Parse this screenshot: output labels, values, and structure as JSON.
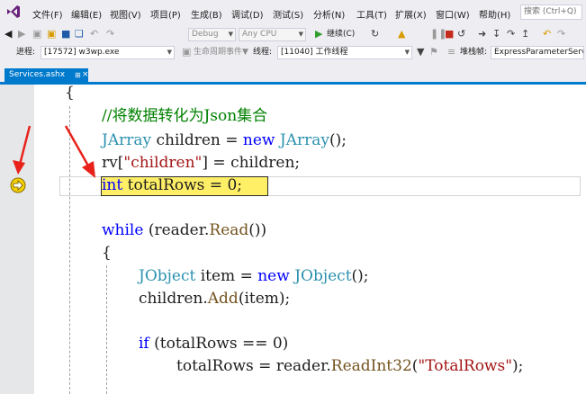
{
  "menubar": {
    "items": [
      {
        "label": "文件(F)"
      },
      {
        "label": "编辑(E)"
      },
      {
        "label": "视图(V)"
      },
      {
        "label": "项目(P)"
      },
      {
        "label": "生成(B)"
      },
      {
        "label": "调试(D)"
      },
      {
        "label": "测试(S)"
      },
      {
        "label": "分析(N)"
      },
      {
        "label": "工具(T)"
      },
      {
        "label": "扩展(X)"
      },
      {
        "label": "窗口(W)"
      },
      {
        "label": "帮助(H)"
      }
    ],
    "search_placeholder": "搜索 (Ctrl+Q)"
  },
  "toolbar": {
    "config": "Debug",
    "platform": "Any CPU",
    "continue_label": "继续(C)",
    "process_label": "进程:",
    "process_value": "[17572] w3wp.exe",
    "lifecycle_label": "生命周期事件",
    "thread_label": "线程:",
    "thread_value": "[11040] 工作线程",
    "stackframe_label": "堆栈帧:",
    "stackframe_value": "ExpressParameterServ"
  },
  "tab": {
    "filename": "Services.ashx",
    "pin_icon": "pin-icon",
    "close_icon": "close-icon"
  },
  "code": {
    "lines": [
      {
        "tokens": [
          {
            "t": "{",
            "c": "plain"
          }
        ]
      },
      {
        "tokens": [
          {
            "t": "//将数据转化为Json集合",
            "c": "cmt"
          }
        ]
      },
      {
        "tokens": [
          {
            "t": "JArray",
            "c": "type"
          },
          {
            "t": " children = ",
            "c": "plain"
          },
          {
            "t": "new",
            "c": "kw"
          },
          {
            "t": " ",
            "c": "plain"
          },
          {
            "t": "JArray",
            "c": "type"
          },
          {
            "t": "();",
            "c": "plain"
          }
        ]
      },
      {
        "tokens": [
          {
            "t": "rv[",
            "c": "plain"
          },
          {
            "t": "\"children\"",
            "c": "str"
          },
          {
            "t": "] = children;",
            "c": "plain"
          }
        ]
      },
      {
        "tokens": [
          {
            "t": "int",
            "c": "kw"
          },
          {
            "t": " totalRows = 0;",
            "c": "plain"
          }
        ]
      },
      {
        "tokens": [
          {
            "t": "",
            "c": "plain"
          }
        ]
      },
      {
        "tokens": [
          {
            "t": "while",
            "c": "kw"
          },
          {
            "t": " (reader.",
            "c": "plain"
          },
          {
            "t": "Read",
            "c": "meth"
          },
          {
            "t": "())",
            "c": "plain"
          }
        ]
      },
      {
        "tokens": [
          {
            "t": "{",
            "c": "plain"
          }
        ]
      },
      {
        "tokens": [
          {
            "t": "JObject",
            "c": "type"
          },
          {
            "t": " item = ",
            "c": "plain"
          },
          {
            "t": "new",
            "c": "kw"
          },
          {
            "t": " ",
            "c": "plain"
          },
          {
            "t": "JObject",
            "c": "type"
          },
          {
            "t": "();",
            "c": "plain"
          }
        ]
      },
      {
        "tokens": [
          {
            "t": "children.",
            "c": "plain"
          },
          {
            "t": "Add",
            "c": "meth"
          },
          {
            "t": "(item);",
            "c": "plain"
          }
        ]
      },
      {
        "tokens": [
          {
            "t": "",
            "c": "plain"
          }
        ]
      },
      {
        "tokens": [
          {
            "t": "if",
            "c": "kw"
          },
          {
            "t": " (totalRows == 0)",
            "c": "plain"
          }
        ]
      },
      {
        "tokens": [
          {
            "t": "totalRows = reader.",
            "c": "plain"
          },
          {
            "t": "ReadInt32",
            "c": "meth"
          },
          {
            "t": "(",
            "c": "plain"
          },
          {
            "t": "\"TotalRows\"",
            "c": "str"
          },
          {
            "t": ");",
            "c": "plain"
          }
        ]
      }
    ]
  },
  "colors": {
    "accent": "#007acc",
    "current_statement": "#ffef67",
    "annotation_arrow": "#e8221b",
    "keyword": "#0000ff",
    "type": "#2b91af",
    "string": "#a31515",
    "comment": "#008000"
  },
  "icons": {
    "logo": "visual-studio-logo-icon",
    "current_statement": "current-statement-arrow-icon"
  }
}
